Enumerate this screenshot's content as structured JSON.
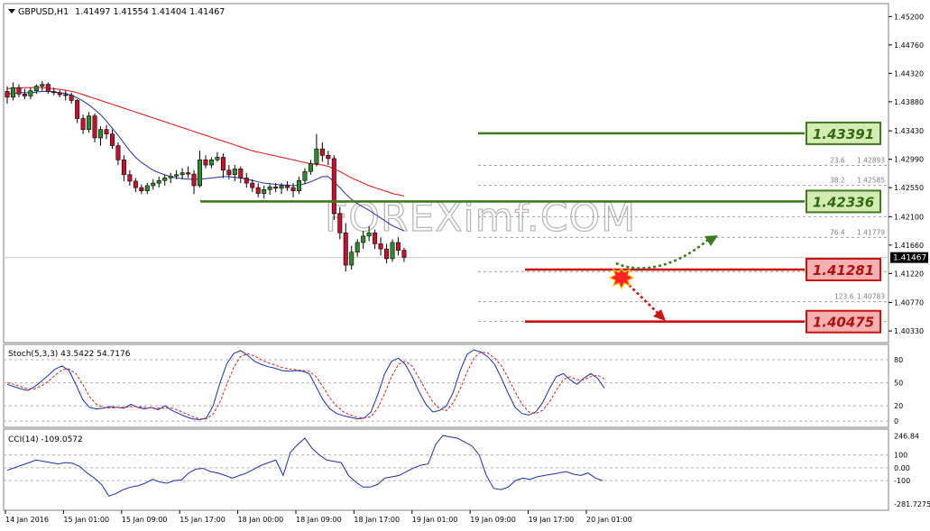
{
  "chart_data": {
    "type": "candlestick",
    "main": {
      "symbol": "GBPUSD,H1",
      "ohlc_text": "1.41497 1.41554 1.41404 1.41467",
      "ylim": [
        1.4015,
        1.454
      ],
      "y_ticks": [
        "1.45200",
        "1.44760",
        "1.44320",
        "1.43880",
        "1.43430",
        "1.42990",
        "1.42550",
        "1.42100",
        "1.41660",
        "1.41220",
        "1.40770",
        "1.40330"
      ],
      "current_price": 1.41467,
      "current_price_label": "1.41467",
      "watermark": "FOREXimf.COM",
      "candles": [
        [
          1.4404,
          1.4412,
          1.4385,
          1.4395
        ],
        [
          1.4395,
          1.4418,
          1.439,
          1.441
        ],
        [
          1.441,
          1.4415,
          1.4395,
          1.44
        ],
        [
          1.44,
          1.4408,
          1.4392,
          1.4397
        ],
        [
          1.4397,
          1.441,
          1.4392,
          1.4405
        ],
        [
          1.4405,
          1.4415,
          1.44,
          1.4412
        ],
        [
          1.4412,
          1.442,
          1.4405,
          1.4415
        ],
        [
          1.4415,
          1.4418,
          1.44,
          1.4404
        ],
        [
          1.4404,
          1.441,
          1.4398,
          1.4402
        ],
        [
          1.4402,
          1.4406,
          1.4395,
          1.4399
        ],
        [
          1.4399,
          1.4405,
          1.439,
          1.4398
        ],
        [
          1.4398,
          1.4402,
          1.4385,
          1.439
        ],
        [
          1.439,
          1.4392,
          1.4355,
          1.4362
        ],
        [
          1.4362,
          1.4368,
          1.4338,
          1.4345
        ],
        [
          1.4345,
          1.4372,
          1.434,
          1.4366
        ],
        [
          1.4366,
          1.437,
          1.4325,
          1.4332
        ],
        [
          1.4332,
          1.435,
          1.432,
          1.4345
        ],
        [
          1.4345,
          1.4352,
          1.433,
          1.4338
        ],
        [
          1.4338,
          1.4345,
          1.4315,
          1.432
        ],
        [
          1.432,
          1.4325,
          1.429,
          1.4298
        ],
        [
          1.4298,
          1.4305,
          1.4265,
          1.4275
        ],
        [
          1.4275,
          1.4282,
          1.4258,
          1.4265
        ],
        [
          1.4265,
          1.427,
          1.4248,
          1.4255
        ],
        [
          1.4255,
          1.426,
          1.4245,
          1.425
        ],
        [
          1.425,
          1.4262,
          1.4245,
          1.4258
        ],
        [
          1.4258,
          1.4268,
          1.4252,
          1.4262
        ],
        [
          1.4262,
          1.4272,
          1.4255,
          1.4266
        ],
        [
          1.4266,
          1.4275,
          1.4258,
          1.427
        ],
        [
          1.427,
          1.4278,
          1.4262,
          1.4273
        ],
        [
          1.4273,
          1.4282,
          1.4268,
          1.4275
        ],
        [
          1.4275,
          1.4285,
          1.4268,
          1.4278
        ],
        [
          1.4278,
          1.4288,
          1.427,
          1.4276
        ],
        [
          1.4276,
          1.4282,
          1.4245,
          1.4258
        ],
        [
          1.4258,
          1.4312,
          1.4255,
          1.4298
        ],
        [
          1.4298,
          1.4305,
          1.4285,
          1.429
        ],
        [
          1.429,
          1.4302,
          1.4285,
          1.4298
        ],
        [
          1.4298,
          1.431,
          1.4295,
          1.4302
        ],
        [
          1.4302,
          1.4308,
          1.427,
          1.4282
        ],
        [
          1.4282,
          1.429,
          1.4268,
          1.4275
        ],
        [
          1.4275,
          1.429,
          1.4265,
          1.4284
        ],
        [
          1.4284,
          1.4288,
          1.4262,
          1.427
        ],
        [
          1.427,
          1.4278,
          1.4255,
          1.4262
        ],
        [
          1.4262,
          1.4268,
          1.4248,
          1.4255
        ],
        [
          1.4255,
          1.4262,
          1.424,
          1.4246
        ],
        [
          1.4246,
          1.4258,
          1.4238,
          1.4252
        ],
        [
          1.4252,
          1.426,
          1.4244,
          1.4256
        ],
        [
          1.4256,
          1.4262,
          1.4248,
          1.4254
        ],
        [
          1.4254,
          1.4262,
          1.4245,
          1.4258
        ],
        [
          1.4258,
          1.4265,
          1.425,
          1.4255
        ],
        [
          1.4255,
          1.4262,
          1.424,
          1.425
        ],
        [
          1.425,
          1.4272,
          1.4245,
          1.4266
        ],
        [
          1.4266,
          1.4285,
          1.426,
          1.428
        ],
        [
          1.428,
          1.4298,
          1.4275,
          1.4292
        ],
        [
          1.4292,
          1.4338,
          1.4288,
          1.4315
        ],
        [
          1.4315,
          1.4325,
          1.4295,
          1.4305
        ],
        [
          1.4305,
          1.4312,
          1.429,
          1.43
        ],
        [
          1.43,
          1.4305,
          1.4205,
          1.4215
        ],
        [
          1.4215,
          1.4225,
          1.4175,
          1.4185
        ],
        [
          1.4185,
          1.42,
          1.4125,
          1.4135
        ],
        [
          1.4135,
          1.4165,
          1.4128,
          1.4155
        ],
        [
          1.4155,
          1.4175,
          1.4148,
          1.417
        ],
        [
          1.417,
          1.4188,
          1.416,
          1.418
        ],
        [
          1.418,
          1.4195,
          1.4172,
          1.4185
        ],
        [
          1.4185,
          1.419,
          1.416,
          1.4168
        ],
        [
          1.4168,
          1.4178,
          1.415,
          1.416
        ],
        [
          1.416,
          1.4168,
          1.4138,
          1.4145
        ],
        [
          1.4145,
          1.4175,
          1.414,
          1.417
        ],
        [
          1.417,
          1.4178,
          1.415,
          1.4158
        ],
        [
          1.4158,
          1.4162,
          1.414,
          1.4147
        ]
      ],
      "ma_slow": [
        1.4408,
        1.4409,
        1.4409,
        1.441,
        1.441,
        1.441,
        1.441,
        1.4409,
        1.4408,
        1.4407,
        1.4406,
        1.4404,
        1.4402,
        1.4399,
        1.4396,
        1.4393,
        1.439,
        1.4387,
        1.4384,
        1.4381,
        1.4378,
        1.4375,
        1.4372,
        1.4369,
        1.4366,
        1.4363,
        1.436,
        1.4357,
        1.4354,
        1.4351,
        1.4348,
        1.4345,
        1.4342,
        1.4339,
        1.4336,
        1.4333,
        1.433,
        1.4327,
        1.4324,
        1.4321,
        1.4318,
        1.4315,
        1.4312,
        1.431,
        1.4308,
        1.4306,
        1.4304,
        1.4302,
        1.43,
        1.4298,
        1.4296,
        1.4294,
        1.4292,
        1.4291,
        1.429,
        1.4288,
        1.4284,
        1.428,
        1.4275,
        1.427,
        1.4266,
        1.4262,
        1.4258,
        1.4255,
        1.4252,
        1.4249,
        1.4246,
        1.4244,
        1.4242
      ],
      "ma_fast": [
        1.44,
        1.4401,
        1.4402,
        1.4402,
        1.4402,
        1.4403,
        1.4404,
        1.4404,
        1.4403,
        1.4402,
        1.4401,
        1.4398,
        1.4394,
        1.4389,
        1.4383,
        1.4376,
        1.4368,
        1.4358,
        1.4347,
        1.4336,
        1.4324,
        1.4312,
        1.4302,
        1.4294,
        1.4288,
        1.4282,
        1.4278,
        1.4275,
        1.4272,
        1.427,
        1.4269,
        1.4268,
        1.4268,
        1.4268,
        1.4269,
        1.427,
        1.4271,
        1.4272,
        1.4272,
        1.4271,
        1.427,
        1.4268,
        1.4266,
        1.4264,
        1.4262,
        1.4261,
        1.426,
        1.4259,
        1.4259,
        1.4258,
        1.4259,
        1.4261,
        1.4264,
        1.4268,
        1.4272,
        1.4272,
        1.4264,
        1.4255,
        1.4245,
        1.4237,
        1.423,
        1.4225,
        1.422,
        1.4214,
        1.4208,
        1.4202,
        1.4196,
        1.4192,
        1.4188
      ],
      "fib_levels": [
        {
          "label": "23.6",
          "price_label": "1.42893",
          "value": 1.42893
        },
        {
          "label": "38.2",
          "price_label": "1.42585",
          "value": 1.42585
        },
        {
          "label": "76.4",
          "price_label": "1.41779",
          "value": 1.41779
        },
        {
          "label": "123.6",
          "price_label": "1.40783",
          "value": 1.40783
        }
      ],
      "fib_extra_lines": [
        1.421,
        1.4125,
        1.4048
      ],
      "resistance_levels": [
        {
          "label": "1.43391",
          "value": 1.43391
        },
        {
          "label": "1.42336",
          "value": 1.42336
        }
      ],
      "support_levels": [
        {
          "label": "1.41281",
          "value": 1.41281
        },
        {
          "label": "1.40475",
          "value": 1.40475
        }
      ]
    },
    "stoch": {
      "title": "Stoch(5,3,3) 43.5422 54.7176",
      "ylim": [
        -8,
        100
      ],
      "y_ticks": [
        "80",
        "50",
        "20",
        "0"
      ],
      "k": [
        48,
        45,
        42,
        40,
        45,
        52,
        60,
        68,
        72,
        66,
        48,
        28,
        18,
        16,
        17,
        19,
        18,
        17,
        22,
        18,
        16,
        18,
        15,
        20,
        14,
        10,
        6,
        3,
        2,
        4,
        20,
        50,
        75,
        88,
        92,
        86,
        78,
        74,
        71,
        69,
        66,
        65,
        66,
        65,
        62,
        45,
        28,
        16,
        10,
        7,
        5,
        3,
        4,
        12,
        35,
        62,
        78,
        82,
        74,
        58,
        38,
        22,
        12,
        14,
        20,
        38,
        66,
        87,
        93,
        90,
        84,
        74,
        56,
        36,
        18,
        10,
        8,
        12,
        24,
        42,
        58,
        62,
        54,
        48,
        56,
        62,
        56,
        43
      ],
      "d": [
        50,
        48,
        45,
        42,
        42,
        46,
        52,
        60,
        67,
        68,
        62,
        48,
        32,
        22,
        18,
        17,
        18,
        18,
        19,
        19,
        18,
        17,
        17,
        17,
        17,
        14,
        10,
        6,
        3,
        3,
        9,
        25,
        48,
        70,
        84,
        88,
        85,
        80,
        76,
        73,
        70,
        68,
        67,
        66,
        65,
        58,
        45,
        30,
        20,
        12,
        8,
        5,
        4,
        6,
        17,
        36,
        58,
        74,
        78,
        72,
        56,
        40,
        25,
        16,
        14,
        24,
        42,
        64,
        82,
        90,
        89,
        82,
        72,
        56,
        38,
        22,
        12,
        10,
        14,
        25,
        40,
        54,
        58,
        54,
        54,
        58,
        60,
        55
      ]
    },
    "cci": {
      "title": "CCI(14) -109.0572",
      "ylim": [
        -330,
        300
      ],
      "y_ticks": [
        "246.84",
        "100",
        "0.00",
        "-100",
        "-281.7275"
      ],
      "values": [
        -20,
        0,
        20,
        40,
        60,
        50,
        40,
        30,
        40,
        35,
        10,
        -40,
        -80,
        -130,
        -220,
        -200,
        -170,
        -150,
        -140,
        -120,
        -90,
        -110,
        -120,
        -100,
        -95,
        -40,
        -10,
        -5,
        -30,
        -40,
        -60,
        -80,
        -60,
        -40,
        -10,
        20,
        40,
        60,
        -60,
        120,
        180,
        230,
        150,
        100,
        60,
        50,
        40,
        -60,
        -110,
        -150,
        -150,
        -130,
        -80,
        -70,
        -60,
        -30,
        0,
        20,
        30,
        180,
        250,
        240,
        230,
        200,
        170,
        100,
        -60,
        -160,
        -170,
        -150,
        -100,
        -80,
        -90,
        -70,
        -60,
        -50,
        -40,
        -30,
        -50,
        -60,
        -40,
        -80,
        -100
      ]
    },
    "x_ticks": [
      "14 Jan 2016",
      "15 Jan 01:00",
      "15 Jan 09:00",
      "15 Jan 17:00",
      "18 Jan 00:00",
      "18 Jan 09:00",
      "18 Jan 17:00",
      "19 Jan 01:00",
      "19 Jan 09:00",
      "19 Jan 17:00",
      "20 Jan 01:00"
    ]
  }
}
